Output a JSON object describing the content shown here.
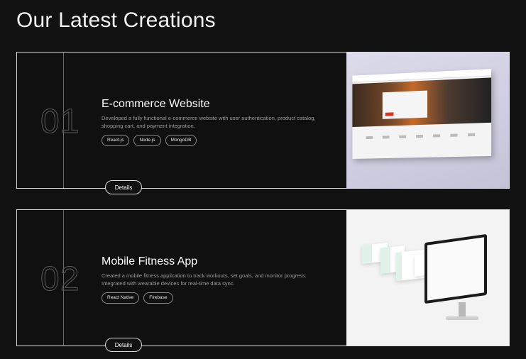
{
  "page": {
    "title": "Our Latest Creations"
  },
  "projects": [
    {
      "number": "01",
      "title": "E-commerce Website",
      "description": "Developed a fully functional e-commerce website with user authentication, product catalog, shopping cart, and payment integration.",
      "tags": [
        "React.js",
        "Node.js",
        "MongoDB"
      ],
      "details_label": "Details",
      "image": "laptop-ecommerce-mockup"
    },
    {
      "number": "02",
      "title": "Mobile Fitness App",
      "description": "Created a mobile fitness application to track workouts, set goals, and monitor progress. Integrated with wearable devices for real-time data sync.",
      "tags": [
        "React Native",
        "Firebase"
      ],
      "details_label": "Details",
      "image": "imac-fitness-mockup"
    }
  ],
  "colors": {
    "background": "#121212",
    "border": "#d9d9d9",
    "number_outline": "#5a5a5a"
  }
}
